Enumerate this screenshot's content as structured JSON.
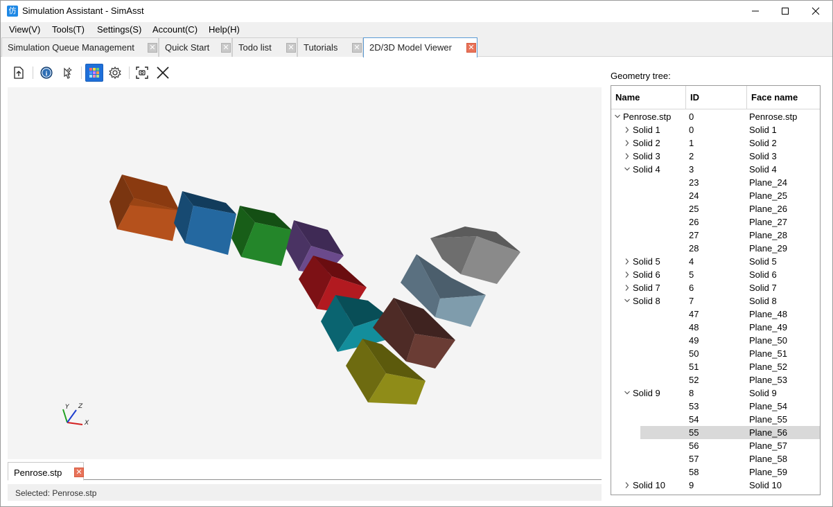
{
  "window": {
    "title": "Simulation Assistant - SimAsst",
    "app_icon_glyph": "仿"
  },
  "menu": [
    "View(V)",
    "Tools(T)",
    "Settings(S)",
    "Account(C)",
    "Help(H)"
  ],
  "tabs": [
    {
      "label": "Simulation Queue Management"
    },
    {
      "label": "Quick Start"
    },
    {
      "label": "Todo list"
    },
    {
      "label": "Tutorials"
    },
    {
      "label": "2D/3D Model Viewer",
      "active": true
    }
  ],
  "toolbar": {
    "buttons": [
      "import-icon",
      "info-icon",
      "magic-select-icon",
      "color-grid-icon",
      "settings-icon",
      "screenshot-icon",
      "close-icon"
    ]
  },
  "axes": {
    "x": "X",
    "y": "Y",
    "z": "Z"
  },
  "file_tab": {
    "label": "Penrose.stp"
  },
  "status": {
    "text": "Selected: Penrose.stp"
  },
  "tree": {
    "label": "Geometry tree:",
    "columns": [
      "Name",
      "ID",
      "Face name"
    ],
    "rows": [
      {
        "name": "Penrose.stp",
        "id": "0",
        "face": "Penrose.stp",
        "level": 0,
        "toggle": "expanded"
      },
      {
        "name": "Solid 1",
        "id": "0",
        "face": "Solid 1",
        "level": 1,
        "toggle": "collapsed"
      },
      {
        "name": "Solid 2",
        "id": "1",
        "face": "Solid 2",
        "level": 1,
        "toggle": "collapsed"
      },
      {
        "name": "Solid 3",
        "id": "2",
        "face": "Solid 3",
        "level": 1,
        "toggle": "collapsed"
      },
      {
        "name": "Solid 4",
        "id": "3",
        "face": "Solid 4",
        "level": 1,
        "toggle": "expanded"
      },
      {
        "name": "",
        "id": "23",
        "face": "Plane_24",
        "level": 2
      },
      {
        "name": "",
        "id": "24",
        "face": "Plane_25",
        "level": 2
      },
      {
        "name": "",
        "id": "25",
        "face": "Plane_26",
        "level": 2
      },
      {
        "name": "",
        "id": "26",
        "face": "Plane_27",
        "level": 2
      },
      {
        "name": "",
        "id": "27",
        "face": "Plane_28",
        "level": 2
      },
      {
        "name": "",
        "id": "28",
        "face": "Plane_29",
        "level": 2
      },
      {
        "name": "Solid 5",
        "id": "4",
        "face": "Solid 5",
        "level": 1,
        "toggle": "collapsed"
      },
      {
        "name": "Solid 6",
        "id": "5",
        "face": "Solid 6",
        "level": 1,
        "toggle": "collapsed"
      },
      {
        "name": "Solid 7",
        "id": "6",
        "face": "Solid 7",
        "level": 1,
        "toggle": "collapsed"
      },
      {
        "name": "Solid 8",
        "id": "7",
        "face": "Solid 8",
        "level": 1,
        "toggle": "expanded"
      },
      {
        "name": "",
        "id": "47",
        "face": "Plane_48",
        "level": 2
      },
      {
        "name": "",
        "id": "48",
        "face": "Plane_49",
        "level": 2
      },
      {
        "name": "",
        "id": "49",
        "face": "Plane_50",
        "level": 2
      },
      {
        "name": "",
        "id": "50",
        "face": "Plane_51",
        "level": 2
      },
      {
        "name": "",
        "id": "51",
        "face": "Plane_52",
        "level": 2
      },
      {
        "name": "",
        "id": "52",
        "face": "Plane_53",
        "level": 2
      },
      {
        "name": "Solid 9",
        "id": "8",
        "face": "Solid 9",
        "level": 1,
        "toggle": "expanded"
      },
      {
        "name": "",
        "id": "53",
        "face": "Plane_54",
        "level": 2
      },
      {
        "name": "",
        "id": "54",
        "face": "Plane_55",
        "level": 2
      },
      {
        "name": "",
        "id": "55",
        "face": "Plane_56",
        "level": 2,
        "selected": true
      },
      {
        "name": "",
        "id": "56",
        "face": "Plane_57",
        "level": 2
      },
      {
        "name": "",
        "id": "57",
        "face": "Plane_58",
        "level": 2
      },
      {
        "name": "",
        "id": "58",
        "face": "Plane_59",
        "level": 2
      },
      {
        "name": "Solid 10",
        "id": "9",
        "face": "Solid 10",
        "level": 1,
        "toggle": "collapsed"
      }
    ]
  },
  "colors": {
    "accent": "#1e6fd9",
    "tab_close_active": "#e8735a",
    "viewport_bg": "#f4f4f4"
  }
}
